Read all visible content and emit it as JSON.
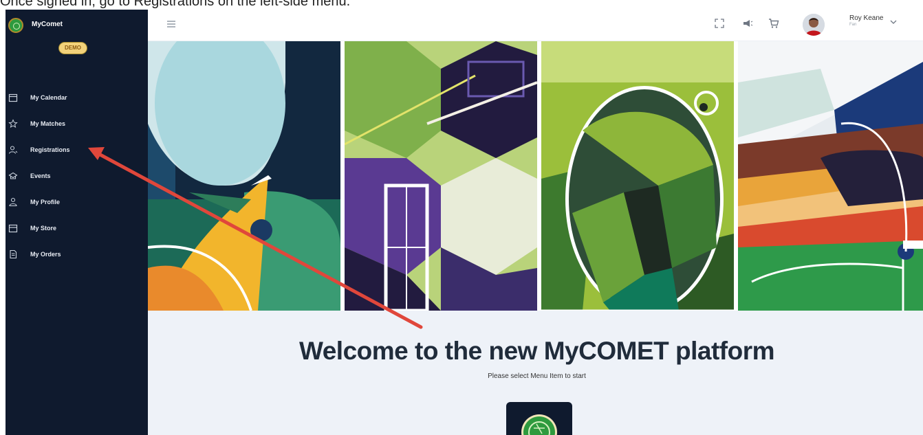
{
  "instruction": "Once signed in, go to Registrations on the left-side menu.",
  "brand": {
    "name": "MyComet",
    "badge": "DEMO"
  },
  "nav": [
    {
      "label": "My Calendar",
      "icon": "calendar-icon"
    },
    {
      "label": "My Matches",
      "icon": "star-icon"
    },
    {
      "label": "Registrations",
      "icon": "user-register-icon"
    },
    {
      "label": "Events",
      "icon": "events-icon"
    },
    {
      "label": "My Profile",
      "icon": "profile-icon"
    },
    {
      "label": "My Store",
      "icon": "store-icon"
    },
    {
      "label": "My Orders",
      "icon": "document-icon"
    }
  ],
  "header": {
    "icons": [
      "hamburger-menu-icon",
      "fullscreen-icon",
      "megaphone-icon",
      "cart-icon",
      "chevron-down-icon"
    ],
    "user": {
      "name": "Roy Keane",
      "role": "Fan"
    }
  },
  "main": {
    "title": "Welcome to the new MyCOMET platform",
    "subtitle": "Please select Menu Item to start"
  },
  "colors": {
    "sidebar": "#0f1a2e",
    "badge": "#f3d27a",
    "content_bg": "#eef2f8",
    "title": "#202c3b",
    "annotation_arrow": "#e0473b"
  }
}
